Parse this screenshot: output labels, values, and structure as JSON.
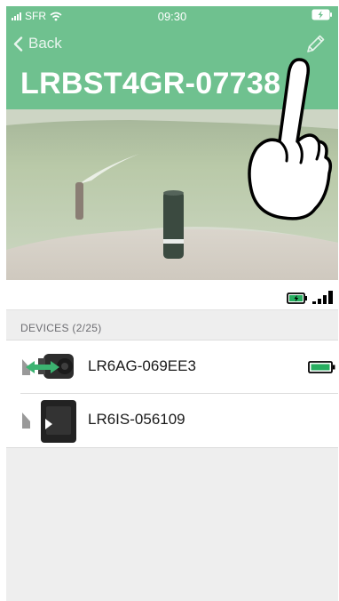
{
  "status_bar": {
    "carrier": "SFR",
    "time": "09:30"
  },
  "nav": {
    "back_label": "Back"
  },
  "device": {
    "title": "LRBST4GR-07738"
  },
  "devices_section": {
    "header": "DEVICES (2/25)"
  },
  "devices": [
    {
      "name": "LR6AG-069EE3",
      "battery_icon": "battery-full-icon"
    },
    {
      "name": "LR6IS-056109"
    }
  ],
  "colors": {
    "header_green": "#6fc18f",
    "accent_green": "#27ae60"
  }
}
